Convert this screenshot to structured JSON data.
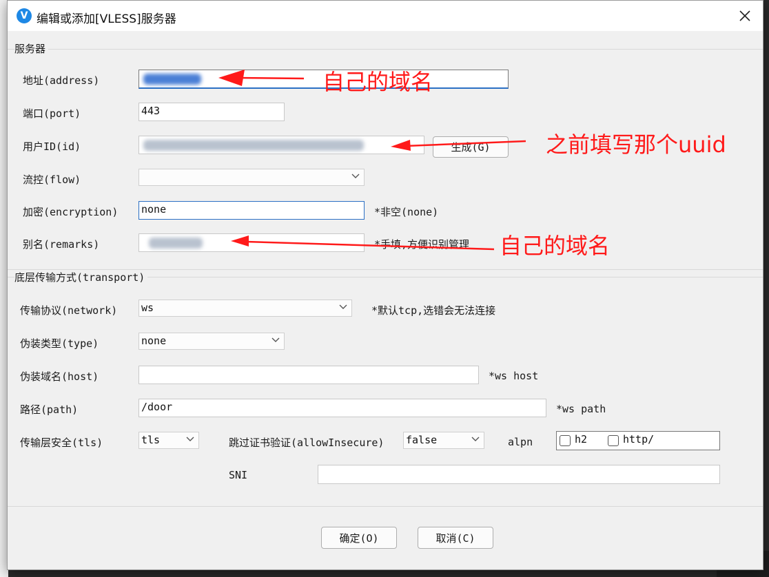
{
  "window": {
    "title": "编辑或添加[VLESS]服务器"
  },
  "sections": {
    "server": "服务器",
    "transport": "底层传输方式(transport)"
  },
  "fields": {
    "address": {
      "label": "地址(address)"
    },
    "port": {
      "label": "端口(port)",
      "value": "443"
    },
    "id": {
      "label": "用户ID(id)",
      "generate": "生成(G)"
    },
    "flow": {
      "label": "流控(flow)",
      "value": ""
    },
    "encryption": {
      "label": "加密(encryption)",
      "value": "none",
      "hint": "*非空(none)"
    },
    "remarks": {
      "label": "别名(remarks)",
      "hint": "*手填,方便识别管理"
    },
    "network": {
      "label": "传输协议(network)",
      "value": "ws",
      "hint": "*默认tcp,选错会无法连接"
    },
    "type": {
      "label": "伪装类型(type)",
      "value": "none"
    },
    "host": {
      "label": "伪装域名(host)",
      "value": "",
      "hint": "*ws host"
    },
    "path": {
      "label": "路径(path)",
      "value": "/door",
      "hint": "*ws path"
    },
    "tls": {
      "label": "传输层安全(tls)",
      "value": "tls"
    },
    "allow_insecure": {
      "label": "跳过证书验证(allowInsecure)",
      "value": "false"
    },
    "alpn": {
      "label": "alpn",
      "options": [
        "h2",
        "http/"
      ]
    },
    "sni": {
      "label": "SNI",
      "value": ""
    }
  },
  "buttons": {
    "ok": "确定(O)",
    "cancel": "取消(C)"
  },
  "annotations": {
    "address": "自己的域名",
    "uuid": "之前填写那个uuid",
    "remarks": "自己的域名"
  },
  "colors": {
    "annotation": "#ff1a1a",
    "focus": "#2a6fc4"
  }
}
